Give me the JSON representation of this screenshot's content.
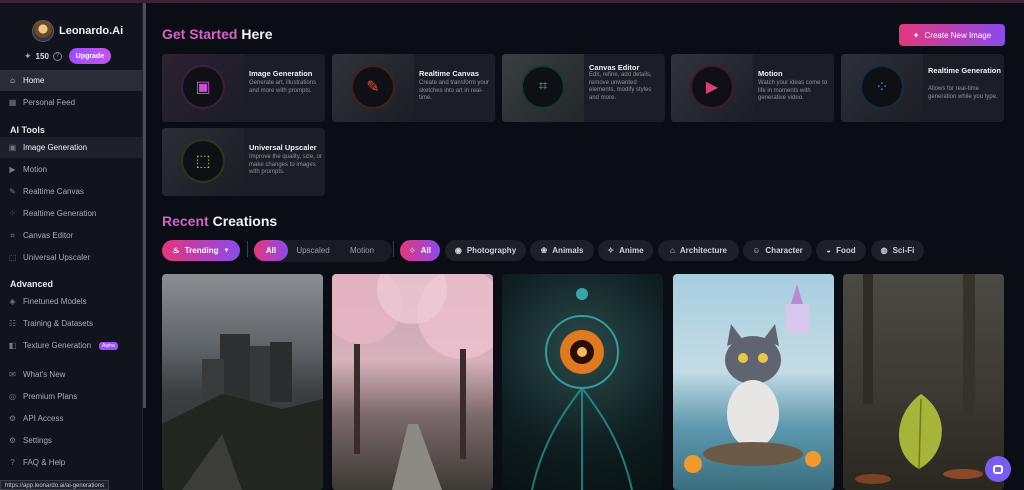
{
  "sidebar": {
    "brand": "Leonardo.Ai",
    "credits": "150",
    "upgrade_label": "Upgrade",
    "items_top": [
      {
        "label": "Home",
        "icon": "home-icon"
      },
      {
        "label": "Personal Feed",
        "icon": "feed-icon"
      }
    ],
    "tools_heading": "AI Tools",
    "tools": [
      {
        "label": "Image Generation",
        "icon": "image-icon"
      },
      {
        "label": "Motion",
        "icon": "motion-icon"
      },
      {
        "label": "Realtime Canvas",
        "icon": "brush-icon"
      },
      {
        "label": "Realtime Generation",
        "icon": "grid-icon"
      },
      {
        "label": "Canvas Editor",
        "icon": "crop-icon"
      },
      {
        "label": "Universal Upscaler",
        "icon": "upscale-icon"
      }
    ],
    "advanced_heading": "Advanced",
    "advanced": [
      {
        "label": "Finetuned Models",
        "icon": "model-icon"
      },
      {
        "label": "Training & Datasets",
        "icon": "dataset-icon"
      },
      {
        "label": "Texture Generation",
        "icon": "texture-icon",
        "badge": "Alpha"
      }
    ],
    "bottom": [
      {
        "label": "What's New",
        "icon": "megaphone-icon"
      },
      {
        "label": "Premium Plans",
        "icon": "plans-icon"
      },
      {
        "label": "API Access",
        "icon": "api-icon"
      },
      {
        "label": "Settings",
        "icon": "gear-icon"
      },
      {
        "label": "FAQ & Help",
        "icon": "help-icon"
      }
    ],
    "status_url": "https://app.leonardo.ai/ai-generations"
  },
  "header": {
    "title_accent": "Get Started",
    "title_rest": "Here",
    "create_label": "Create New Image"
  },
  "cards": [
    {
      "title": "Image Generation",
      "desc": "Generate art, illustrations and more with prompts.",
      "color": "#c94fd6"
    },
    {
      "title": "Realtime Canvas",
      "desc": "Create and transform your sketches into art in real-time.",
      "color": "#e0562f"
    },
    {
      "title": "Canvas Editor",
      "desc": "Edit, refine, add details, remove unwanted elements, modify styles and more.",
      "color": "#31c48d"
    },
    {
      "title": "Motion",
      "desc": "Watch your ideas come to life in moments with generative video.",
      "color": "#d8407a"
    },
    {
      "title": "Realtime Generation",
      "desc": "Allows for real-time generation while you type.",
      "color": "#3e7be6"
    },
    {
      "title": "Universal Upscaler",
      "desc": "Improve the quality, size, or make changes to images with prompts.",
      "color": "#a7c73a"
    }
  ],
  "recent": {
    "title_accent": "Recent",
    "title_rest": "Creations",
    "trending_label": "Trending",
    "seg": [
      "All",
      "Upscaled",
      "Motion"
    ],
    "categories": [
      "All",
      "Photography",
      "Animals",
      "Anime",
      "Architecture",
      "Character",
      "Food",
      "Sci-Fi"
    ]
  }
}
